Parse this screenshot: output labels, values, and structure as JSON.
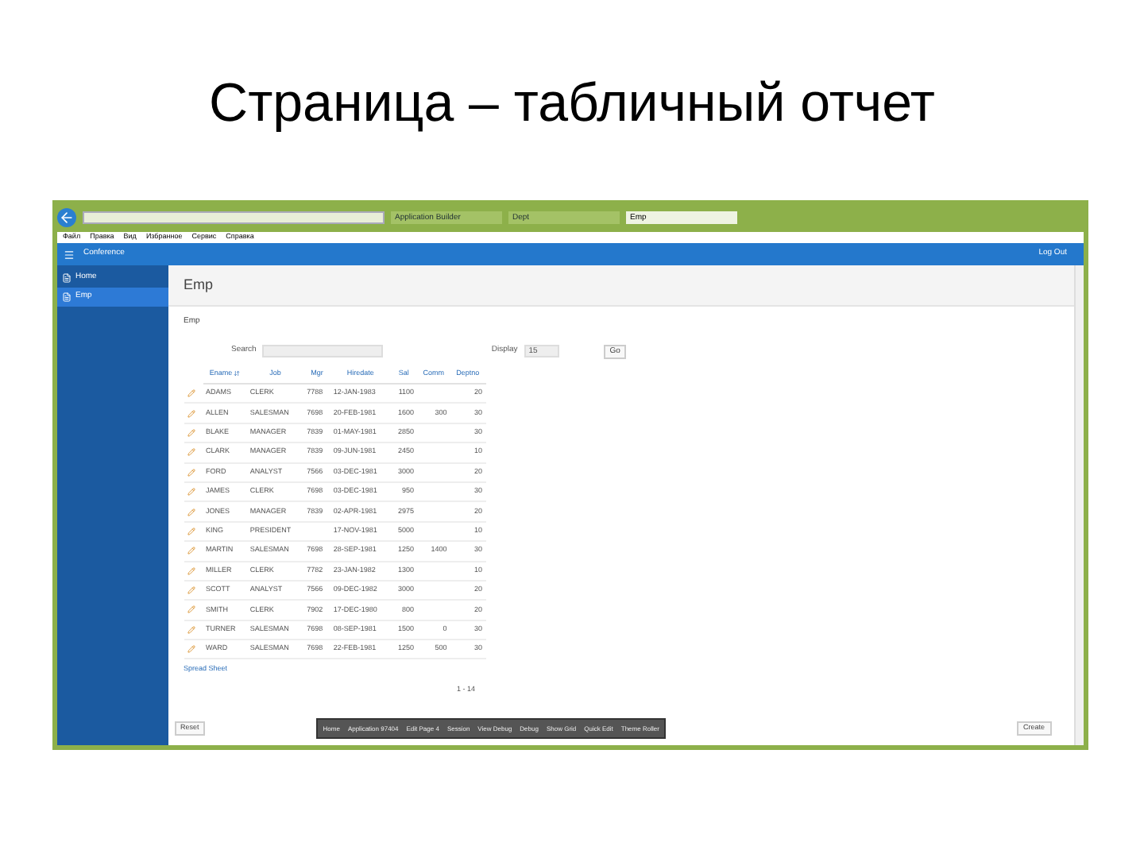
{
  "slide_title": "Страница – табличный отчет",
  "browser": {
    "tabs": [
      {
        "label": "Application Builder",
        "selected": false
      },
      {
        "label": "Dept",
        "selected": false
      },
      {
        "label": "Emp",
        "selected": true
      }
    ],
    "menu": [
      "Файл",
      "Правка",
      "Вид",
      "Избранное",
      "Сервис",
      "Справка"
    ]
  },
  "app": {
    "title": "Conference",
    "logout": "Log Out"
  },
  "sidebar": [
    {
      "label": "Home",
      "selected": false
    },
    {
      "label": "Emp",
      "selected": true
    }
  ],
  "page_title": "Emp",
  "region_title": "Emp",
  "search": {
    "label": "Search"
  },
  "display": {
    "label": "Display",
    "value": "15"
  },
  "go_button": "Go",
  "table": {
    "columns": [
      {
        "label": "Ename",
        "sorted": true
      },
      {
        "label": "Job",
        "sorted": false
      },
      {
        "label": "Mgr",
        "sorted": false
      },
      {
        "label": "Hiredate",
        "sorted": false
      },
      {
        "label": "Sal",
        "sorted": false
      },
      {
        "label": "Comm",
        "sorted": false
      },
      {
        "label": "Deptno",
        "sorted": false
      }
    ],
    "rows": [
      [
        "ADAMS",
        "CLERK",
        "7788",
        "12-JAN-1983",
        "1100",
        null,
        "20"
      ],
      [
        "ALLEN",
        "SALESMAN",
        "7698",
        "20-FEB-1981",
        "1600",
        "300",
        "30"
      ],
      [
        "BLAKE",
        "MANAGER",
        "7839",
        "01-MAY-1981",
        "2850",
        null,
        "30"
      ],
      [
        "CLARK",
        "MANAGER",
        "7839",
        "09-JUN-1981",
        "2450",
        null,
        "10"
      ],
      [
        "FORD",
        "ANALYST",
        "7566",
        "03-DEC-1981",
        "3000",
        null,
        "20"
      ],
      [
        "JAMES",
        "CLERK",
        "7698",
        "03-DEC-1981",
        "950",
        null,
        "30"
      ],
      [
        "JONES",
        "MANAGER",
        "7839",
        "02-APR-1981",
        "2975",
        null,
        "20"
      ],
      [
        "KING",
        "PRESIDENT",
        null,
        "17-NOV-1981",
        "5000",
        null,
        "10"
      ],
      [
        "MARTIN",
        "SALESMAN",
        "7698",
        "28-SEP-1981",
        "1250",
        "1400",
        "30"
      ],
      [
        "MILLER",
        "CLERK",
        "7782",
        "23-JAN-1982",
        "1300",
        null,
        "10"
      ],
      [
        "SCOTT",
        "ANALYST",
        "7566",
        "09-DEC-1982",
        "3000",
        null,
        "20"
      ],
      [
        "SMITH",
        "CLERK",
        "7902",
        "17-DEC-1980",
        "800",
        null,
        "20"
      ],
      [
        "TURNER",
        "SALESMAN",
        "7698",
        "08-SEP-1981",
        "1500",
        "0",
        "30"
      ],
      [
        "WARD",
        "SALESMAN",
        "7698",
        "22-FEB-1981",
        "1250",
        "500",
        "30"
      ]
    ]
  },
  "spreadsheet_link": "Spread Sheet",
  "pagination": "1 - 14",
  "reset_button": "Reset",
  "create_button": "Create",
  "developer_toolbar": [
    "Home",
    "Application 97404",
    "Edit Page 4",
    "Session",
    "View Debug",
    "Debug",
    "Show Grid",
    "Quick Edit",
    "Theme Roller"
  ]
}
